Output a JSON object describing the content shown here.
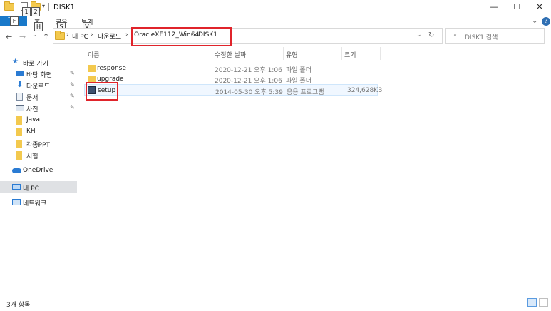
{
  "window": {
    "title": "DISK1",
    "minimize": "—",
    "maximize": "☐",
    "close": "✕"
  },
  "quick_access_keytips": [
    "1",
    "2"
  ],
  "ribbon": {
    "file_tab": "파일",
    "tabs": [
      "홈",
      "공유",
      "보기"
    ],
    "keytips": [
      "F",
      "H",
      "S",
      "V"
    ]
  },
  "nav": {
    "back": "←",
    "forward": "→",
    "recent": "⌄",
    "up": "↑",
    "dropdown": "⌄",
    "refresh": "↻"
  },
  "breadcrumb": [
    "내 PC",
    "다운로드",
    "OracleXE112_Win64",
    "DISK1"
  ],
  "search": {
    "placeholder": "DISK1 검색"
  },
  "sidebar": {
    "quick_access": "바로 가기",
    "items": [
      {
        "label": "바탕 화면",
        "pinned": true
      },
      {
        "label": "다운로드",
        "pinned": true
      },
      {
        "label": "문서",
        "pinned": true
      },
      {
        "label": "사진",
        "pinned": true
      },
      {
        "label": "Java",
        "pinned": false
      },
      {
        "label": "KH",
        "pinned": false
      },
      {
        "label": "각종PPT",
        "pinned": false
      },
      {
        "label": "시험",
        "pinned": false
      }
    ],
    "onedrive": "OneDrive",
    "this_pc": "내 PC",
    "network": "네트워크"
  },
  "columns": [
    "이름",
    "수정한 날짜",
    "유형",
    "크기"
  ],
  "files": [
    {
      "name": "response",
      "date": "2020-12-21 오후 1:06",
      "type": "파일 폴더",
      "size": "",
      "icon": "folder-icon"
    },
    {
      "name": "upgrade",
      "date": "2020-12-21 오후 1:06",
      "type": "파일 폴더",
      "size": "",
      "icon": "folder-icon"
    },
    {
      "name": "setup",
      "date": "2014-05-30 오후 5:39",
      "type": "응용 프로그램",
      "size": "324,628KB",
      "icon": "application-icon"
    }
  ],
  "status": {
    "item_count": "3개 항목"
  },
  "colors": {
    "accent": "#1979ca",
    "highlight": "#e0242b",
    "folder": "#f3c94e"
  }
}
